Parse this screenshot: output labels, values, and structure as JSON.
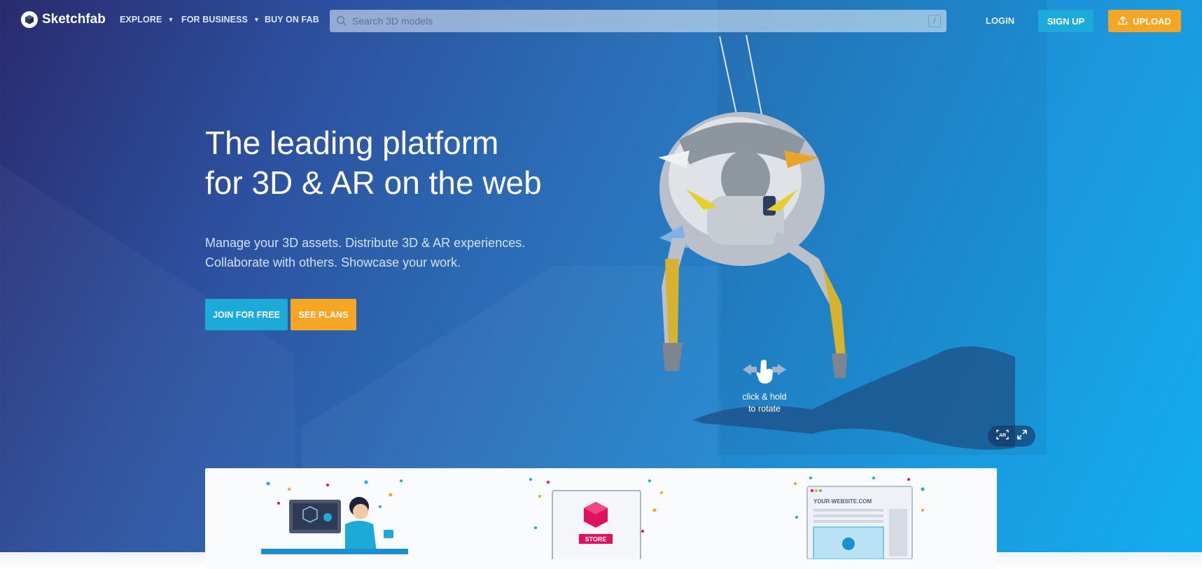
{
  "brand": {
    "name": "Sketchfab"
  },
  "nav": {
    "explore": "EXPLORE",
    "for_business": "FOR BUSINESS",
    "buy_on_fab": "BUY ON FAB"
  },
  "search": {
    "placeholder": "Search 3D models",
    "shortcut": "/"
  },
  "auth": {
    "login": "LOGIN",
    "signup": "SIGN UP",
    "upload": "UPLOAD"
  },
  "hero": {
    "title_line1": "The leading platform",
    "title_line2": "for 3D & AR on the web",
    "sub_line1": "Manage your 3D assets. Distribute 3D & AR experiences.",
    "sub_line2": "Collaborate with others. Showcase your work.",
    "join_label": "JOIN FOR FREE",
    "plans_label": "SEE PLANS"
  },
  "viewer": {
    "hint_line1": "click & hold",
    "hint_line2": "to rotate",
    "ar_label": "AR"
  },
  "features": {
    "store_label": "STORE",
    "website_label": "YOUR-WEBSITE.COM"
  },
  "colors": {
    "accent_blue": "#1caad9",
    "accent_orange": "#f6a623",
    "store_pink": "#e0115f"
  }
}
